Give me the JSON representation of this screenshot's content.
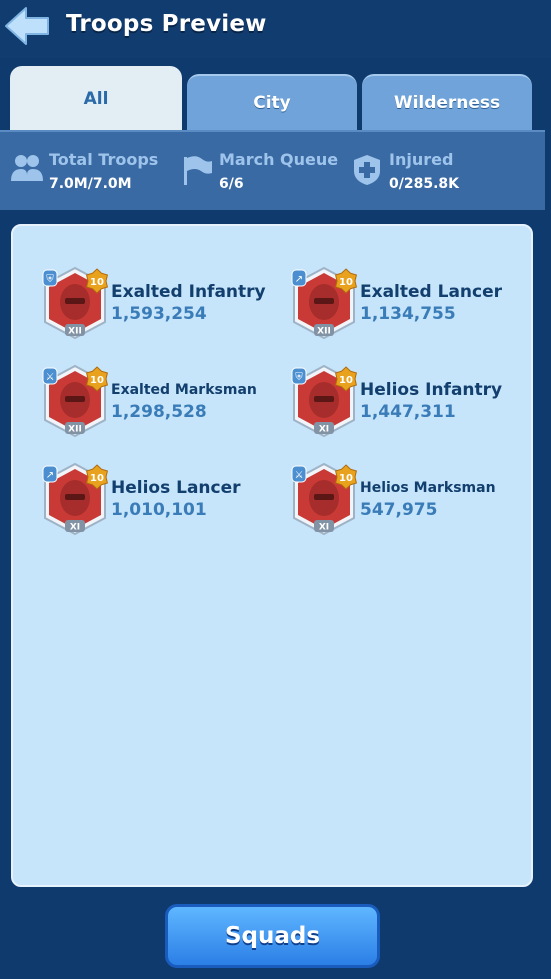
{
  "header": {
    "title": "Troops Preview"
  },
  "tabs": [
    {
      "label": "All",
      "active": true
    },
    {
      "label": "City",
      "active": false
    },
    {
      "label": "Wilderness",
      "active": false
    }
  ],
  "stats": [
    {
      "label": "Total Troops",
      "value": "7.0M/7.0M",
      "icon": "people-icon"
    },
    {
      "label": "March Queue",
      "value": "6/6",
      "icon": "flag-icon"
    },
    {
      "label": "Injured",
      "value": "0/285.8K",
      "icon": "medical-cross-icon"
    }
  ],
  "troops": [
    {
      "name": "Exalted Infantry",
      "count": "1,593,254",
      "level": "10",
      "tier": "XII",
      "type": "shield-icon"
    },
    {
      "name": "Exalted Lancer",
      "count": "1,134,755",
      "level": "10",
      "tier": "XII",
      "type": "lance-icon"
    },
    {
      "name": "Exalted Marksman",
      "count": "1,298,528",
      "level": "10",
      "tier": "XII",
      "type": "crossbow-icon"
    },
    {
      "name": "Helios Infantry",
      "count": "1,447,311",
      "level": "10",
      "tier": "XI",
      "type": "shield-icon"
    },
    {
      "name": "Helios Lancer",
      "count": "1,010,101",
      "level": "10",
      "tier": "XI",
      "type": "lance-icon"
    },
    {
      "name": "Helios Marksman",
      "count": "547,975",
      "level": "10",
      "tier": "XI",
      "type": "crossbow-icon"
    }
  ],
  "footer": {
    "squads_label": "Squads"
  },
  "colors": {
    "background": "#0f3a6e",
    "panel": "#c6e4fa",
    "accent": "#2b7fe6",
    "badge_red": "#c93a36",
    "level_gold": "#e8a21d"
  }
}
